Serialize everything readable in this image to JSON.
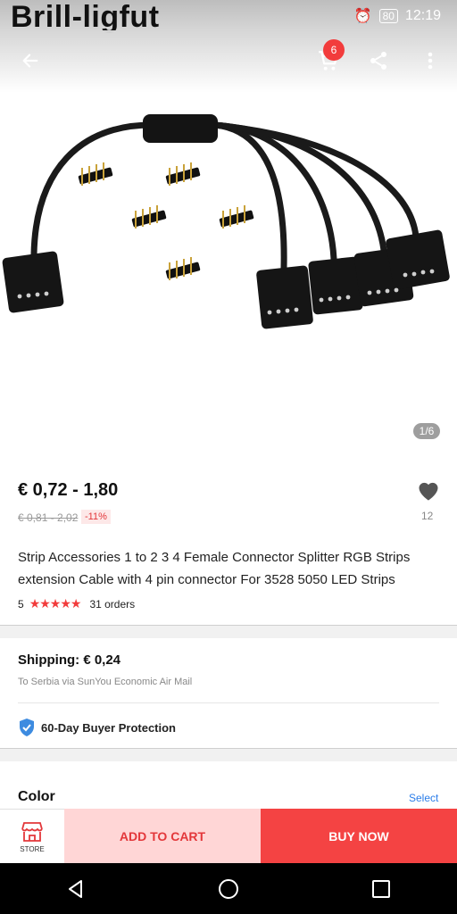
{
  "watermark": "Brill-ligfut",
  "status_bar": {
    "battery": "80",
    "time": "12:19"
  },
  "header": {
    "cart_count": "6"
  },
  "gallery": {
    "indicator": "1/6"
  },
  "price": {
    "current": "€ 0,72 - 1,80",
    "original": "€ 0,81 - 2,02",
    "discount": "-11%",
    "wishlist_count": "12"
  },
  "product": {
    "title": "Strip Accessories 1 to 2 3 4  Female Connector Splitter RGB Strips extension Cable with 4 pin connector For 3528 5050 LED Strips",
    "rating": "5",
    "orders": "31 orders"
  },
  "shipping": {
    "title": "Shipping: € 0,24",
    "detail": "To Serbia via SunYou Economic Air Mail",
    "protection": "60-Day Buyer Protection"
  },
  "variants": {
    "label": "Color",
    "select_label": "Select"
  },
  "actions": {
    "store": "STORE",
    "add_to_cart": "ADD TO CART",
    "buy_now": "BUY NOW"
  },
  "colors": {
    "accent": "#f44343",
    "add_cart_bg": "#ffd6d6",
    "link": "#2b7de9"
  }
}
